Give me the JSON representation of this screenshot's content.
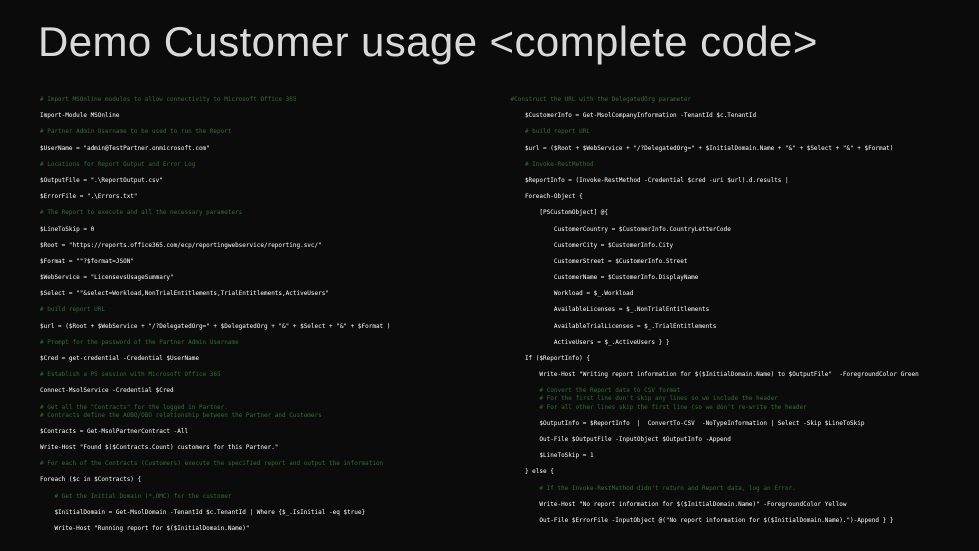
{
  "title": "Demo Customer usage <complete code>",
  "left": {
    "c1": "# Import MSOnline modules to allow connectivity to Microsoft Office 365",
    "l2": "Import-Module MSOnline",
    "c3": "# Partner Admin Username to be used to run the Report",
    "l4": "$UserName = \"admin@TestPartner.onmicrosoft.com\"",
    "c5": "# Locations for Report Output and Error Log",
    "l6": "$OutputFile = \".\\ReportOutput.csv\"",
    "l7": "$ErrorFile = \".\\Errors.txt\"",
    "c8": "# The Report to execute and all the necessary parameters",
    "l9": "$LineToSkip = 0",
    "l10": "$Root = \"https://reports.office365.com/ecp/reportingwebservice/reporting.svc/\"",
    "l11": "$Format = \"\"?$format=JSON\"",
    "l12": "$WebService = \"LicensevsUsageSummary\"",
    "l13": "$Select = \"\"&select=Workload,NonTrialEntitlements,TrialEntitlements,ActiveUsers\"",
    "c14": "# build report URL",
    "l15": "$url = ($Root + $WebService + \"/?DelegatedOrg=\" + $DelegatedOrg + \"&\" + $Select + \"&\" + $Format )",
    "c16": "# Prompt for the password of the Partner Admin Username",
    "l17": "$Cred = get-credential -Credential $UserName",
    "c18": "# Establish a PS session with Microsoft Office 365",
    "l19": "Connect-MsolService -Credential $Cred",
    "c20": "# Get all the \"Contracts\" for the logged in Partner.",
    "c20b": "# Contracts define the AOBO/OBO relationship between the Partner and Customers",
    "l21": "$Contracts = Get-MsolPartnerContract -All",
    "l22": "Write-Host \"Found $($Contracts.Count) customers for this Partner.\"",
    "c23": "# For each of the Contracts (Customers) execute the specified report and output the information",
    "l24": "Foreach ($c in $Contracts) {",
    "c25": "    # Get the Initial Domain (*.OMC) for the customer",
    "l26": "    $InitialDomain = Get-MsolDomain -TenantId $c.TenantId | Where {$_.IsInitial -eq $true}",
    "l27": "    Write-Host \"Running report for $($InitialDomain.Name)\""
  },
  "right": {
    "c1": "#Construct the URL with the DelegatedOrg parameter",
    "l2": "    $CustomerInfo = Get-MsolCompanyInformation -TenantId $c.TenantId",
    "c3": "    # build report URL",
    "l4": "    $url = ($Root + $WebService + \"/?DelegatedOrg=\" + $InitialDomain.Name + \"&\" + $Select + \"&\" + $Format)",
    "c5": "    # Invoke-RestMethod",
    "l6": "    $ReportInfo = (Invoke-RestMethod -Credential $cred -uri $url).d.results |",
    "l7": "    Foreach-Object {",
    "l8": "        [PSCustomObject] @{",
    "l9": "            CustomerCountry = $CustomerInfo.CountryLetterCode",
    "l10": "            CustomerCity = $CustomerInfo.City",
    "l11": "            CustomerStreet = $CustomerInfo.Street",
    "l12": "            CustomerName = $CustomerInfo.DisplayName",
    "l13": "            Workload = $_.Workload",
    "l14": "            AvailableLicenses = $_.NonTrialEntitlements",
    "l15": "            AvailableTrialLicenses = $_.TrialEntitlements",
    "l16": "            ActiveUsers = $_.ActiveUsers } }",
    "l17": "    If ($ReportInfo) {",
    "l18": "        Write-Host \"Writing report information for $($InitialDomain.Name) to $OutputFile\"  -ForegroundColor Green",
    "c19": "        # Convert the Report data to CSV format",
    "c20": "        # For the first line don't skip any lines so we include the header",
    "c21": "        # For all other lines skip the first line (so we don't re-write the header",
    "l22": "        $OutputInfo = $ReportInfo  |  ConvertTo-CSV  -NoTypeInformation | Select -Skip $LineToSkip",
    "l23": "        Out-File $OutputFile -InputObject $OutputInfo -Append",
    "l24": "        $LineToSkip = 1",
    "l25": "    } else {",
    "c26": "        # If the Invoke-RestMethod didn't return and Report data, log an Error.",
    "l27": "        Write-Host \"No report information for $($InitialDomain.Name)\" -ForegroundColor Yellow",
    "l28": "        Out-File $ErrorFile -InputObject @(\"No report information for $($InitialDomain.Name).\")-Append } }"
  }
}
